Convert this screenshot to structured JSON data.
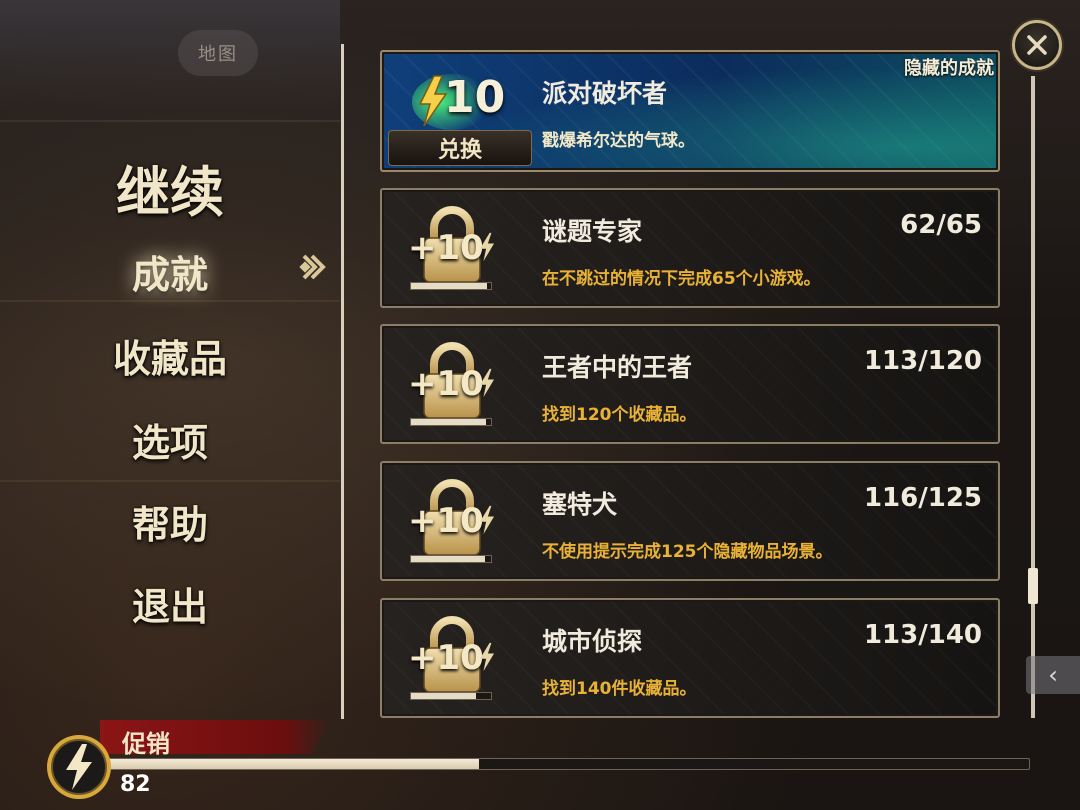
{
  "top_bar": {
    "map_label": "地图"
  },
  "menu": {
    "continue_label": "继续",
    "items": [
      {
        "label": "成就"
      },
      {
        "label": "收藏品"
      },
      {
        "label": "选项"
      },
      {
        "label": "帮助"
      },
      {
        "label": "退出"
      }
    ]
  },
  "achievements": {
    "featured": {
      "tag": "隐藏的成就",
      "reward": "10",
      "redeem_label": "兑换",
      "title": "派对破坏者",
      "description": "戳爆希尔达的气球。"
    },
    "items": [
      {
        "title": "谜题专家",
        "description": "在不跳过的情况下完成65个小游戏。",
        "progress": "62/65",
        "reward": "+10",
        "ratio": 0.954
      },
      {
        "title": "王者中的王者",
        "description": "找到120个收藏品。",
        "progress": "113/120",
        "reward": "+10",
        "ratio": 0.942
      },
      {
        "title": "塞特犬",
        "description": "不使用提示完成125个隐藏物品场景。",
        "progress": "116/125",
        "reward": "+10",
        "ratio": 0.928
      },
      {
        "title": "城市侦探",
        "description": "找到140件收藏品。",
        "progress": "113/140",
        "reward": "+10",
        "ratio": 0.807
      }
    ]
  },
  "bottom": {
    "promo_label": "促销",
    "energy_value": "82",
    "energy_ratio": 0.405
  },
  "icons": {
    "close": "close-icon",
    "lock": "lock-icon",
    "bolt": "lightning-icon",
    "selector": "selector-icon",
    "side_tab": "chevron-left-icon"
  },
  "colors": {
    "accent_gold": "#e9b236",
    "cream_text": "#f2e6c8",
    "promo_red": "#8c1515",
    "featured_blue": "#0f3f7a"
  }
}
